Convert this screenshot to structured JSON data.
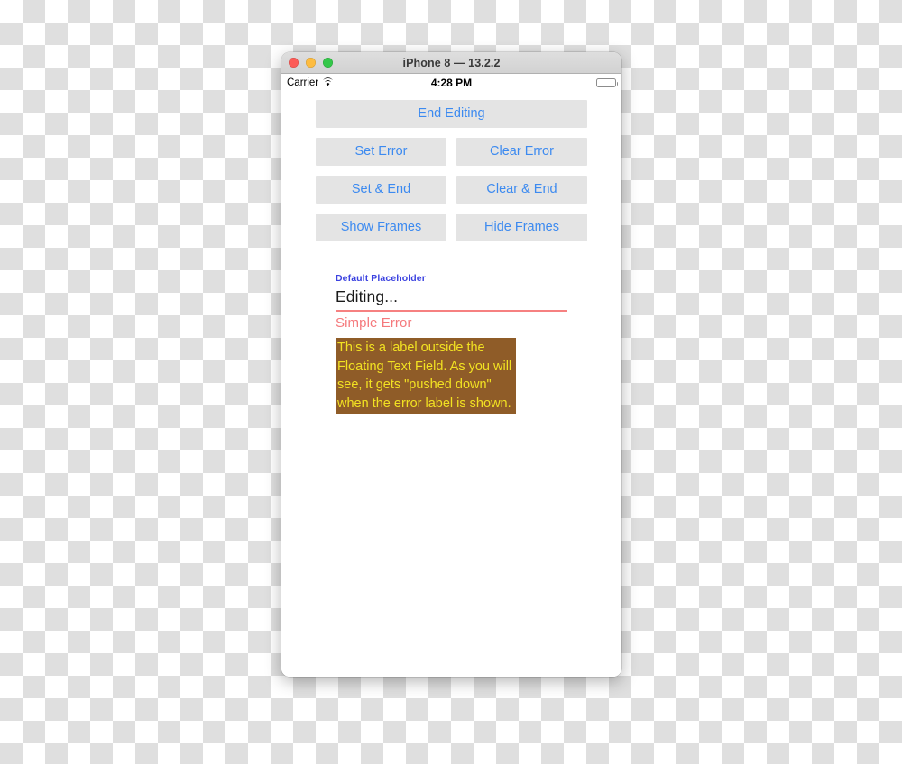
{
  "window": {
    "title": "iPhone 8 — 13.2.2",
    "traffic_lights": [
      "close",
      "minimize",
      "maximize"
    ]
  },
  "status_bar": {
    "carrier": "Carrier",
    "wifi_icon": "wifi-icon",
    "time": "4:28 PM",
    "battery_icon": "battery-full-icon"
  },
  "buttons": {
    "rows": [
      [
        {
          "label": "End Editing",
          "name": "end-editing-button"
        }
      ],
      [
        {
          "label": "Set Error",
          "name": "set-error-button"
        },
        {
          "label": "Clear Error",
          "name": "clear-error-button"
        }
      ],
      [
        {
          "label": "Set & End",
          "name": "set-and-end-button"
        },
        {
          "label": "Clear & End",
          "name": "clear-and-end-button"
        }
      ],
      [
        {
          "label": "Show Frames",
          "name": "show-frames-button"
        },
        {
          "label": "Hide Frames",
          "name": "hide-frames-button"
        }
      ]
    ]
  },
  "text_field": {
    "placeholder": "Default Placeholder",
    "value": "Editing...",
    "error": "Simple Error"
  },
  "outside_label": {
    "text": "This is a label outside the Floating Text Field. As you will see, it gets \"pushed down\" when the error label is shown."
  },
  "colors": {
    "button_background": "#e4e4e4",
    "button_text": "#3c8af0",
    "placeholder_text": "#3b42e0",
    "error_text": "#f5797c",
    "underline": "#f68181",
    "label_background": "#8f5c28",
    "label_text": "#f2e222",
    "titlebar": "#d6d6d6"
  }
}
